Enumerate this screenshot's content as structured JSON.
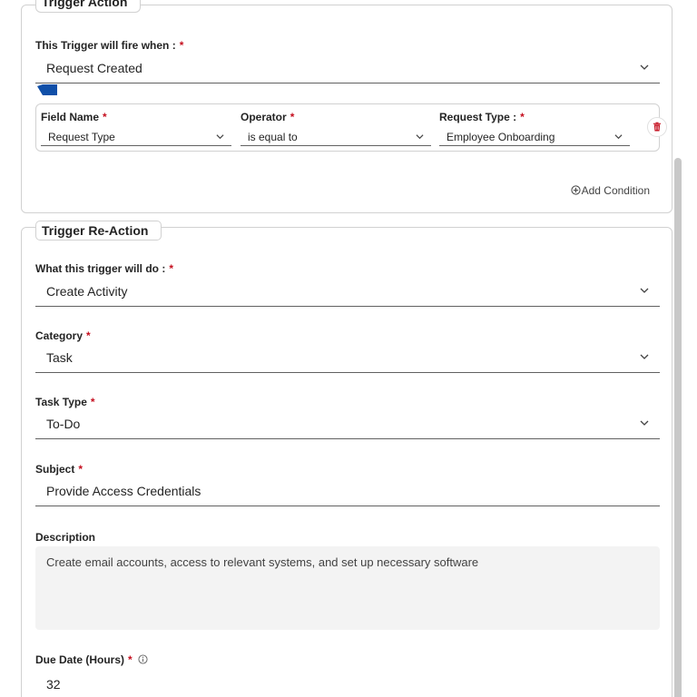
{
  "trigger_action": {
    "legend": "Trigger Action",
    "fire_when_label": "This Trigger will fire when :",
    "fire_when_value": "Request Created",
    "conditions": {
      "field_name_label": "Field Name",
      "field_name_value": "Request Type",
      "operator_label": "Operator",
      "operator_value": "is equal to",
      "request_type_label": "Request Type :",
      "request_type_value": "Employee Onboarding"
    },
    "add_condition": "Add Condition"
  },
  "trigger_reaction": {
    "legend": "Trigger Re-Action",
    "what_label": "What this trigger will do :",
    "what_value": "Create Activity",
    "category_label": "Category",
    "category_value": "Task",
    "task_type_label": "Task Type",
    "task_type_value": "To-Do",
    "subject_label": "Subject",
    "subject_value": "Provide Access Credentials",
    "description_label": "Description",
    "description_value": "Create email accounts, access to relevant systems, and set up necessary software",
    "due_date_label": "Due Date (Hours)",
    "due_date_value": "32"
  },
  "required_mark": "*",
  "colors": {
    "required": "#c50f1f",
    "accent_blue": "#0f4fa8",
    "delete_red": "#c50f1f"
  },
  "icons": [
    "chevron-down-icon",
    "trash-icon",
    "add-circle-icon",
    "info-icon"
  ]
}
